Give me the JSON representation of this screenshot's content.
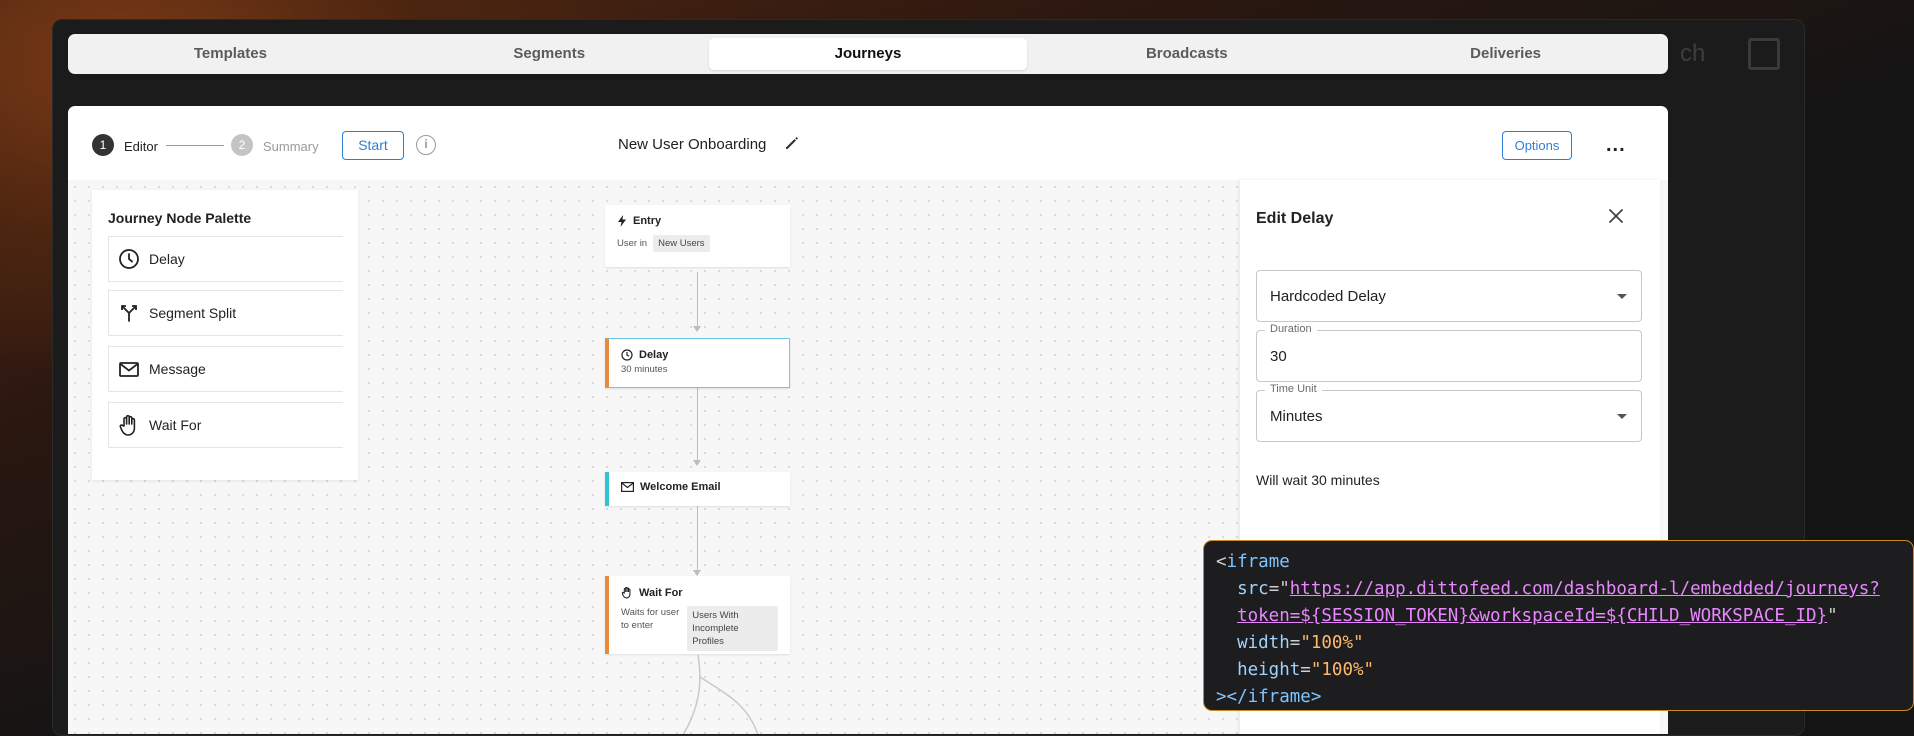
{
  "tabs": [
    {
      "label": "Templates",
      "active": false
    },
    {
      "label": "Segments",
      "active": false
    },
    {
      "label": "Journeys",
      "active": true
    },
    {
      "label": "Broadcasts",
      "active": false
    },
    {
      "label": "Deliveries",
      "active": false
    }
  ],
  "background": {
    "partial_text": "ch"
  },
  "toolbar": {
    "steps": [
      {
        "number": "1",
        "label": "Editor",
        "active": true
      },
      {
        "number": "2",
        "label": "Summary",
        "active": false
      }
    ],
    "start_label": "Start",
    "info_glyph": "i",
    "journey_title": "New User Onboarding",
    "options_label": "Options",
    "more_glyph": "..."
  },
  "palette": {
    "title": "Journey Node Palette",
    "items": [
      {
        "label": "Delay",
        "icon": "clock-icon"
      },
      {
        "label": "Segment Split",
        "icon": "split-icon"
      },
      {
        "label": "Message",
        "icon": "mail-icon"
      },
      {
        "label": "Wait For",
        "icon": "hand-icon"
      }
    ]
  },
  "nodes": {
    "entry": {
      "title": "Entry",
      "sub": "User in",
      "pill": "New Users"
    },
    "delay": {
      "title": "Delay",
      "sub": "30 minutes"
    },
    "email": {
      "title": "Welcome Email"
    },
    "wait": {
      "title": "Wait For",
      "sub_line1": "Waits for user",
      "sub_line2": "to enter",
      "pill_line1": "Users With",
      "pill_line2": "Incomplete Profiles"
    }
  },
  "edit_panel": {
    "title": "Edit Delay",
    "delay_type": "Hardcoded Delay",
    "duration_label": "Duration",
    "duration_value": "30",
    "time_unit_label": "Time Unit",
    "time_unit_value": "Minutes",
    "summary": "Will wait  30 minutes"
  },
  "code": {
    "open_tag": "<",
    "tag": "iframe",
    "src_attr": "src",
    "src_url_line1": "https://app.dittofeed.com/dashboard-l/embedded/journeys?",
    "src_url_line2": "token=${SESSION_TOKEN}&workspaceId=${CHILD_WORKSPACE_ID}",
    "width_attr": "width",
    "width_value": "\"100%\"",
    "height_attr": "height",
    "height_value": "\"100%\"",
    "close": "></iframe>"
  },
  "colors": {
    "accent": "#2f7fd1",
    "delay_border": "#e8893b",
    "email_border": "#2fc3d6",
    "wait_border": "#e8893b",
    "code_border": "#c98a2c"
  }
}
